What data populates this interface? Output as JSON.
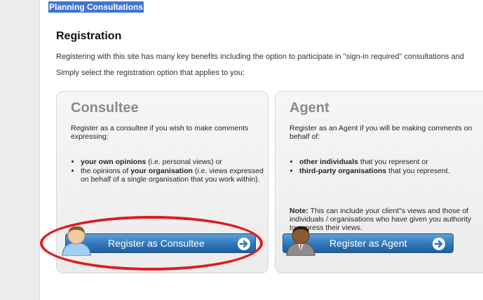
{
  "breadcrumb": "Planning Consultations",
  "page_title": "Registration",
  "intro": {
    "line1": "Registering with this site has many key benefits including the option to participate in \"sign-in required\" consultations and",
    "line2": "Simply select the registration option that applies to you:"
  },
  "consultee": {
    "title": "Consultee",
    "desc": "Register as a consultee if you wish to make comments expressing:",
    "items": [
      {
        "bold": "your own opinions",
        "text": " (i.e. personal views) or"
      },
      {
        "pre": "the opinions of ",
        "bold": "your organisation",
        "text": " (i.e. views expressed on behalf of a single organisation that you work within)."
      }
    ],
    "button_label": "Register as Consultee"
  },
  "agent": {
    "title": "Agent",
    "desc": "Register as an Agent if you will be making comments on behalf of:",
    "items": [
      {
        "bold": "other individuals",
        "text": " that you represent or"
      },
      {
        "bold": "third-party organisations",
        "text": " that you represent."
      }
    ],
    "note_label": "Note:",
    "note_text": " This can include your client\"s views and those of individuals / organisations who have given you authority to express their views.",
    "button_label": "Register as Agent"
  },
  "colors": {
    "highlight": "#e01b1b",
    "button": "#2f77bb",
    "breadcrumb_bg": "#3f73d6"
  }
}
